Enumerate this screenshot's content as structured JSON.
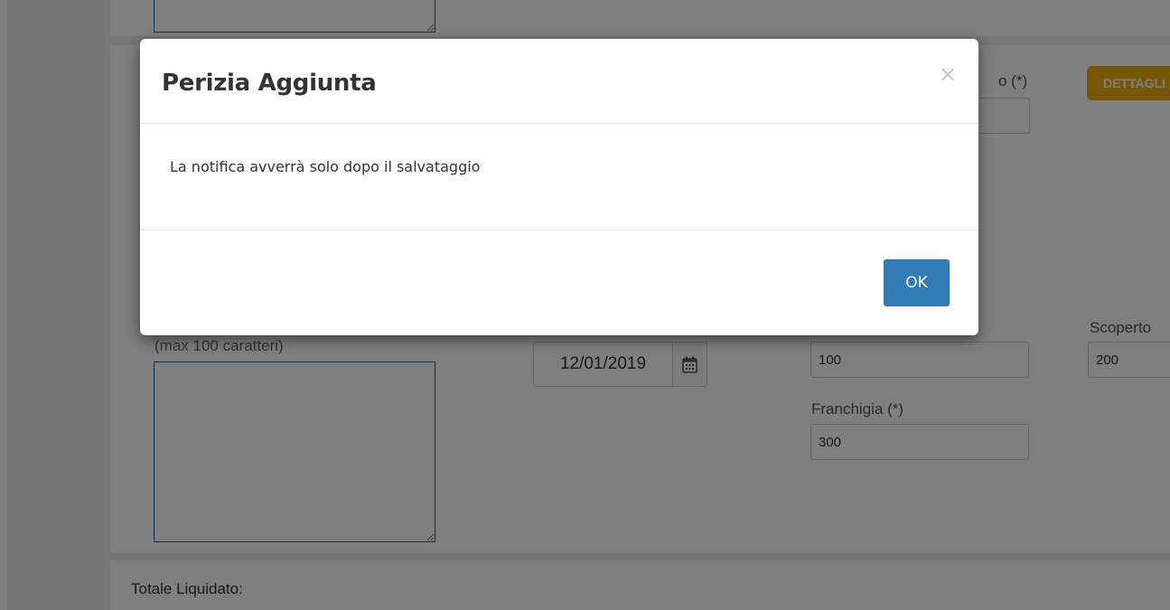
{
  "background": {
    "top_textarea_value": "",
    "note_hint": "(max 100 caratteri)",
    "note_value": "",
    "required_label_fragment": "o (*)",
    "details_button": "DETTAGLI",
    "date_value": "12/01/2019",
    "calendar_icon": "calendar-icon",
    "field_100_value": "100",
    "franchigia_label": "Franchigia (*)",
    "field_300_value": "300",
    "scoperto_label": "Scoperto",
    "field_200_value": "200",
    "totale_label": "Totale Liquidato:"
  },
  "modal": {
    "title": "Perizia Aggiunta",
    "close_glyph": "×",
    "message": "La notifica avverrà solo dopo il salvataggio",
    "ok_label": "OK"
  },
  "colors": {
    "primary": "#337ab7",
    "warning": "#f0ad0e",
    "backdrop": "rgba(0,0,0,0.5)"
  }
}
